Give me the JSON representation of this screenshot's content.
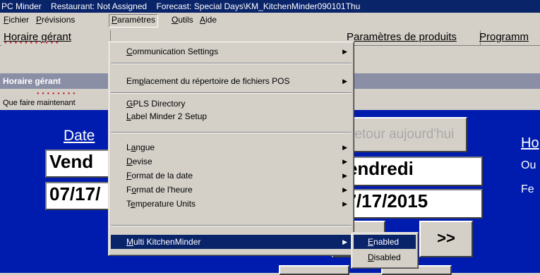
{
  "title_bar": {
    "app": "PC Minder",
    "restaurant": "Restaurant: Not Assigned",
    "forecast": "Forecast: Special Days\\KM_KitchenMinder090101Thu"
  },
  "menubar": {
    "file_prefix": "F",
    "file_rest": "ichier",
    "forecast_prefix": "P",
    "forecast_rest": "révisions",
    "params_prefix": "P",
    "params_rest": "aramètres",
    "tools_prefix": "O",
    "tools_rest": "utils",
    "help_prefix": "A",
    "help_rest": "ide"
  },
  "tabs": {
    "manager_schedule": "Horaire gérant",
    "product_params": "Paramètres de produits",
    "programs": "Programm"
  },
  "panel": {
    "header": "Horaire gérant",
    "info_label": "Que faire maintenant"
  },
  "main": {
    "date_label": "Date",
    "day_left": "Vend",
    "date_left": "07/17/",
    "return_today": "Retour aujourd'hui",
    "day_right": "Vendredi",
    "date_right": "07/17/2015",
    "next_btn": ">>",
    "hours_label": "Ho",
    "open_label": "Ou",
    "close_label": "Fe"
  },
  "params_menu": {
    "communication": {
      "prefix": "C",
      "rest": "ommunication Settings"
    },
    "pos_dir": {
      "before": "Em",
      "key": "p",
      "after": "lacement du répertoire de fichiers POS"
    },
    "gpls": {
      "prefix": "G",
      "rest": "PLS Directory"
    },
    "label_minder": {
      "prefix": "L",
      "rest": "abel Minder 2 Setup"
    },
    "language": {
      "before": "L",
      "key": "a",
      "after": "ngue"
    },
    "currency": {
      "prefix": "D",
      "rest": "evise"
    },
    "date_format": {
      "prefix": "F",
      "rest": "ormat de la date"
    },
    "time_format": {
      "before": "F",
      "key": "o",
      "after": "rmat de l'heure"
    },
    "temp_units": {
      "before": "T",
      "key": "e",
      "after": "mperature Units"
    },
    "multi_km": {
      "prefix": "M",
      "rest": "ulti KitchenMinder"
    }
  },
  "submenu": {
    "enabled": {
      "prefix": "E",
      "rest": "nabled"
    },
    "disabled": {
      "prefix": "D",
      "rest": "isabled"
    }
  },
  "icons": {
    "submenu_arrow": "▶"
  },
  "colors": {
    "title_bar": "#0a246a",
    "main_bg": "#001cae",
    "highlight": "#0a246a"
  }
}
